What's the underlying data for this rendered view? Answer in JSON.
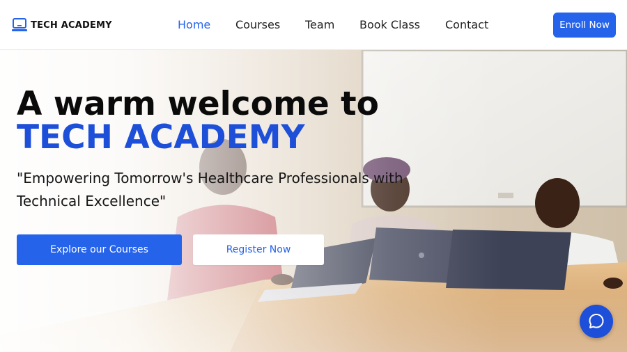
{
  "brand": {
    "name": "TECH ACADEMY",
    "icon": "laptop-icon"
  },
  "nav": {
    "items": [
      {
        "label": "Home",
        "active": true
      },
      {
        "label": "Courses",
        "active": false
      },
      {
        "label": "Team",
        "active": false
      },
      {
        "label": "Book Class",
        "active": false
      },
      {
        "label": "Contact",
        "active": false
      }
    ],
    "enroll_label": "Enroll Now"
  },
  "hero": {
    "title_line1": "A warm welcome to",
    "title_line2": "TECH ACADEMY",
    "tagline": "\"Empowering Tomorrow's Healthcare Professionals with Technical Excellence\"",
    "primary_cta": "Explore our Courses",
    "secondary_cta": "Register Now",
    "background": "students-working-on-laptops-photo"
  },
  "chat": {
    "icon": "chat-bubble-icon"
  },
  "colors": {
    "accent": "#2563eb",
    "title_accent": "#1d4fd8",
    "text": "#111111",
    "background": "#ffffff"
  }
}
